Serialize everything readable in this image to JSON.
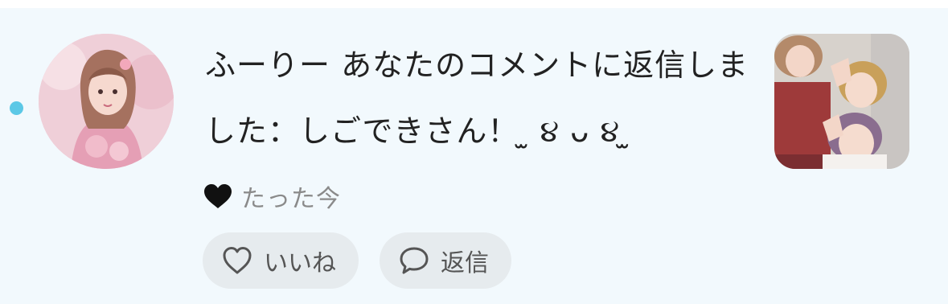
{
  "notification": {
    "sender_name": "ふーりー",
    "message_text": "あなたのコメントに返信しました：しごできさん！ ̫ ૪ ᴗ ૪ ̫",
    "timestamp": "たった今",
    "unread": true,
    "accent_color": "#5cc8e6",
    "background_color": "#f2f9fd"
  },
  "actions": {
    "like_label": "いいね",
    "reply_label": "返信"
  },
  "icons": {
    "avatar": "user-avatar",
    "reaction": "heart-icon",
    "like": "heart-outline-icon",
    "reply": "speech-bubble-icon",
    "thumbnail": "post-thumbnail"
  }
}
